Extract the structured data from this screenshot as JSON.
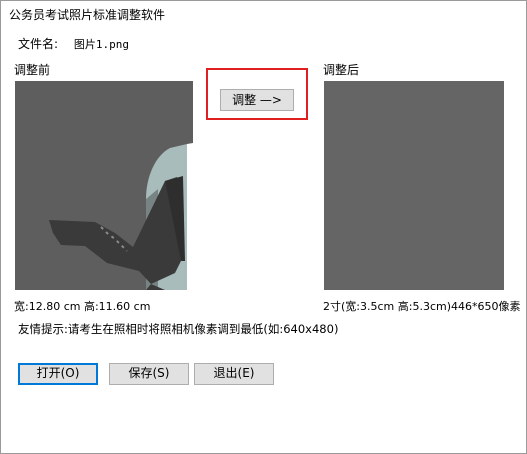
{
  "window": {
    "title": "公务员考试照片标准调整软件"
  },
  "file": {
    "label": "文件名:",
    "name": "图片1.png"
  },
  "before": {
    "label": "调整前",
    "dimensions": "宽:12.80 cm 高:11.60 cm"
  },
  "after": {
    "label": "调整后",
    "dimensions": "2寸(宽:3.5cm 高:5.3cm)446*650像素"
  },
  "actions": {
    "adjust_label": "调整 —>",
    "open_label": "打开(O)",
    "save_label": "保存(S)",
    "exit_label": "退出(E)"
  },
  "tip": "友情提示:请考生在照相时将照相机像素调到最低(如:640x480)",
  "colors": {
    "panel": "#5e5e5e",
    "highlight": "#e02020",
    "focus": "#0078d7",
    "button": "#e1e1e1"
  }
}
